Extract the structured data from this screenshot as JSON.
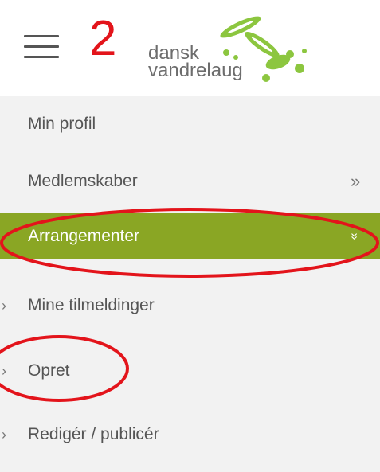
{
  "annotation": {
    "number": "2",
    "color": "#e3141b"
  },
  "logo": {
    "line1": "dansk",
    "line2": "vandrelaug",
    "accent": "#8cc63f"
  },
  "menu": {
    "items": [
      {
        "label": "Min profil",
        "chevron": ""
      },
      {
        "label": "Medlemskaber",
        "chevron": "»"
      },
      {
        "label": "Arrangementer",
        "chevron": "»",
        "active": true
      }
    ],
    "subitems": [
      {
        "bullet": "›",
        "label": "Mine tilmeldinger"
      },
      {
        "bullet": "›",
        "label": "Opret"
      },
      {
        "bullet": "›",
        "label": "Redigér / publicér"
      }
    ],
    "active_color": "#8aa624"
  },
  "icons": {
    "menu": "hamburger-icon",
    "expand": "chevron-double-right-icon",
    "collapse": "chevron-double-down-icon"
  }
}
